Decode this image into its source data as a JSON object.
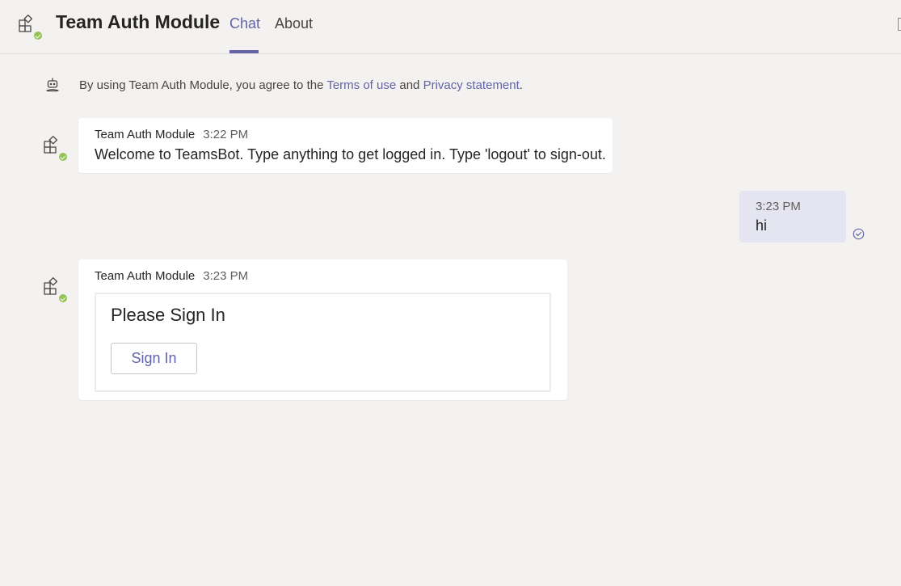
{
  "header": {
    "app_title": "Team Auth Module",
    "app_icon": "apps-icon",
    "status": "available",
    "tabs": [
      {
        "label": "Chat",
        "active": true
      },
      {
        "label": "About",
        "active": false
      }
    ]
  },
  "notice": {
    "prefix": "By using Team Auth Module, you agree to the ",
    "terms_link": "Terms of use",
    "connector": " and ",
    "privacy_link": "Privacy statement",
    "suffix": "."
  },
  "messages": [
    {
      "sender": "Team Auth Module",
      "time": "3:22 PM",
      "text": "Welcome to TeamsBot. Type anything to get logged in. Type 'logout' to sign-out."
    },
    {
      "from_me": true,
      "time": "3:23 PM",
      "text": "hi",
      "status_icon": "seen-check-icon"
    },
    {
      "sender": "Team Auth Module",
      "time": "3:23 PM",
      "card": {
        "title": "Please Sign In",
        "button_label": "Sign In"
      }
    }
  ],
  "colors": {
    "background": "#f3f2f1",
    "accent": "#6264a7",
    "status_available": "#92c353",
    "my_message_bg": "#e5e5f1",
    "card_bg": "#ffffff"
  }
}
